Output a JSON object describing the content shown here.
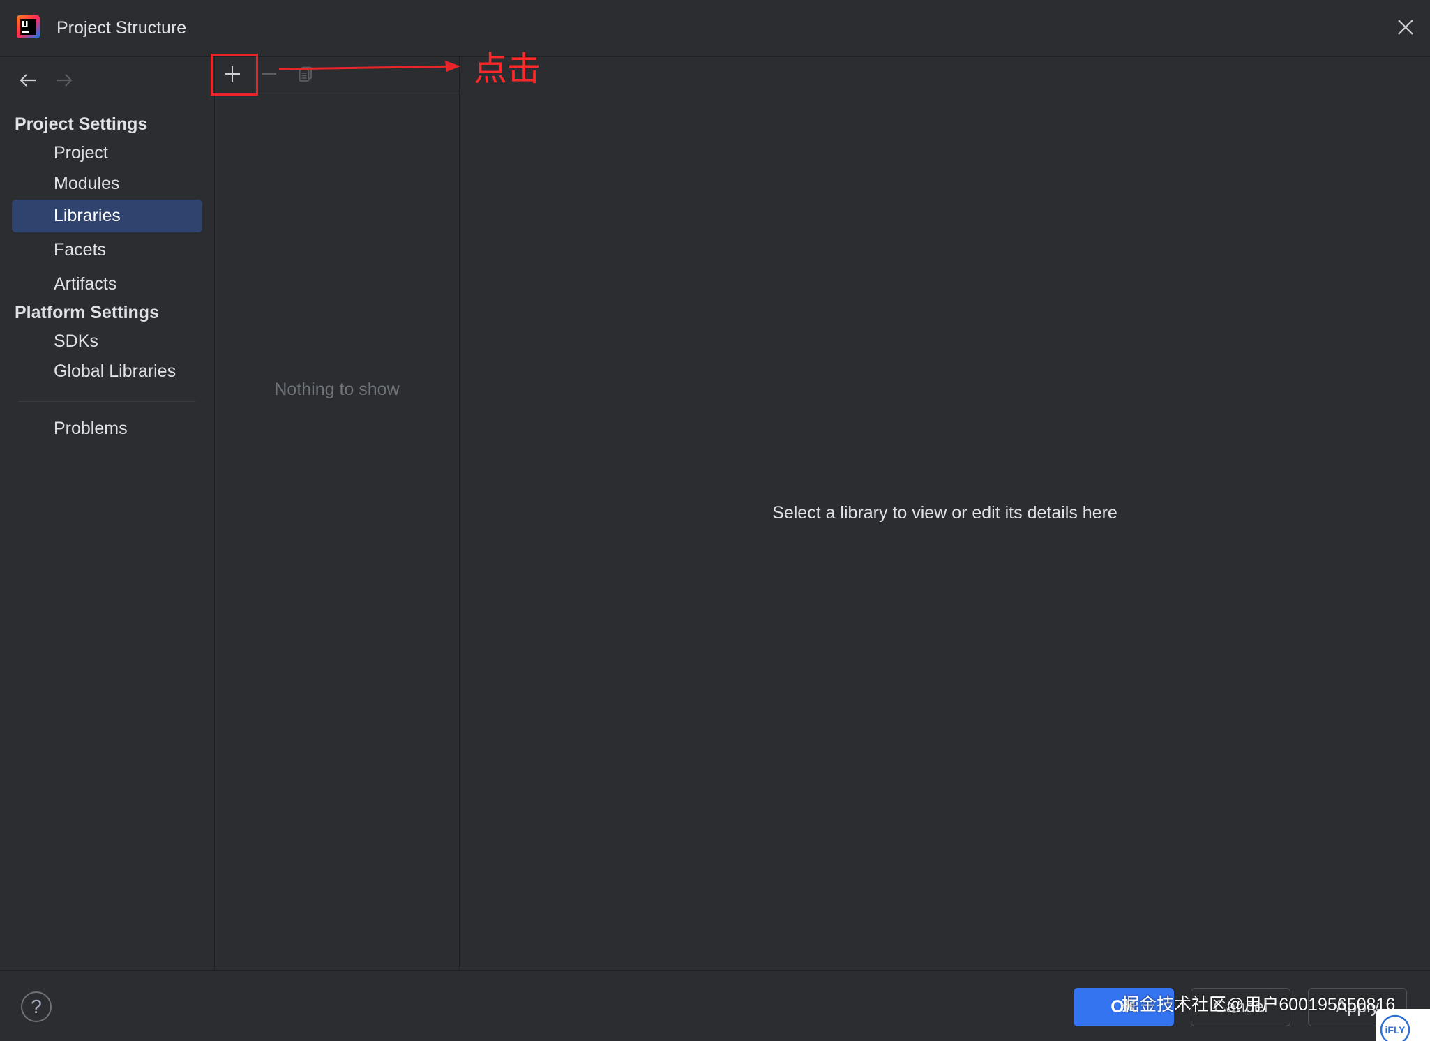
{
  "window": {
    "title": "Project Structure",
    "app_icon": "intellij-idea-icon",
    "app_logo_text": "IJ",
    "close_icon": "close-icon"
  },
  "navigation": {
    "back_icon": "arrow-left-icon",
    "forward_icon": "arrow-right-icon",
    "forward_enabled": false
  },
  "sidebar": {
    "sections": [
      {
        "heading": "Project Settings",
        "items": [
          {
            "label": "Project"
          },
          {
            "label": "Modules"
          },
          {
            "label": "Libraries",
            "selected": true
          },
          {
            "label": "Facets"
          },
          {
            "label": "Artifacts"
          }
        ]
      },
      {
        "heading": "Platform Settings",
        "items": [
          {
            "label": "SDKs"
          },
          {
            "label": "Global Libraries"
          }
        ]
      }
    ],
    "footer_items": [
      {
        "label": "Problems"
      }
    ]
  },
  "library_list": {
    "toolbar": {
      "add_icon": "plus-icon",
      "remove_icon": "minus-icon",
      "copy_icon": "copy-icon",
      "remove_enabled": false,
      "copy_enabled": false
    },
    "empty_text": "Nothing to show"
  },
  "details": {
    "empty_text": "Select a library to view or edit its details here"
  },
  "annotation": {
    "label": "点击",
    "color": "#e8262a"
  },
  "footer": {
    "help_icon": "question-circle-icon",
    "help_label": "?",
    "ok_label": "OK",
    "cancel_label": "Cancel",
    "apply_label": "Apply"
  },
  "watermark": {
    "text": "掘金技术社区@用户600195650816"
  },
  "badge": {
    "text": "iFLY"
  },
  "colors": {
    "background": "#2b2d30",
    "border": "#1e1f22",
    "selection": "#2e436e",
    "primary_button": "#3574f0",
    "muted_text": "#6f737a"
  }
}
